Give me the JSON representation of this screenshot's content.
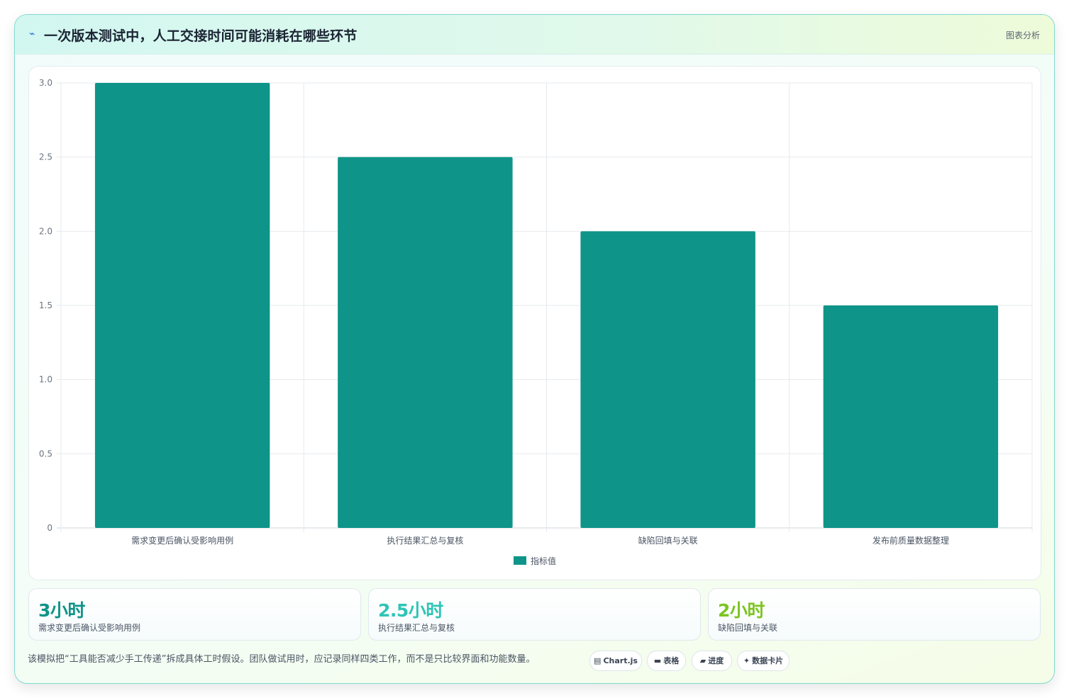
{
  "header": {
    "icon": "lightning-icon",
    "title": "一次版本测试中，人工交接时间可能消耗在哪些环节",
    "tag": "图表分析"
  },
  "chart_data": {
    "type": "bar",
    "categories": [
      "需求变更后确认受影响用例",
      "执行结果汇总与复核",
      "缺陷回填与关联",
      "发布前质量数据整理"
    ],
    "series": [
      {
        "name": "指标值",
        "values": [
          3,
          2.5,
          2,
          1.5
        ],
        "color": "#0e9488"
      }
    ],
    "ylim": [
      0,
      3
    ],
    "yticks": [
      "0",
      "0.5",
      "1.0",
      "1.5",
      "2.0",
      "2.5",
      "3.0"
    ],
    "grid": true,
    "legend": "bottom-center",
    "title": "",
    "xlabel": "",
    "ylabel": ""
  },
  "stats": [
    {
      "value": "3小时",
      "label": "需求变更后确认受影响用例",
      "color": "#0e9488"
    },
    {
      "value": "2.5小时",
      "label": "执行结果汇总与复核",
      "color": "#2ec4b6"
    },
    {
      "value": "2小时",
      "label": "缺陷回填与关联",
      "color": "#7cc520"
    }
  ],
  "footer": {
    "note": "该模拟把“工具能否减少手工传递”拆成具体工时假设。团队做试用时，应记录同样四类工作，而不是只比较界面和功能数量。",
    "pills": [
      {
        "icon": "chart-icon",
        "glyph": "▤",
        "label": "Chart.js"
      },
      {
        "icon": "table-icon",
        "glyph": "▬",
        "label": "表格"
      },
      {
        "icon": "progress-icon",
        "glyph": "▰",
        "label": "进度"
      },
      {
        "icon": "sparkle-icon",
        "glyph": "✦",
        "label": "数据卡片"
      }
    ]
  }
}
